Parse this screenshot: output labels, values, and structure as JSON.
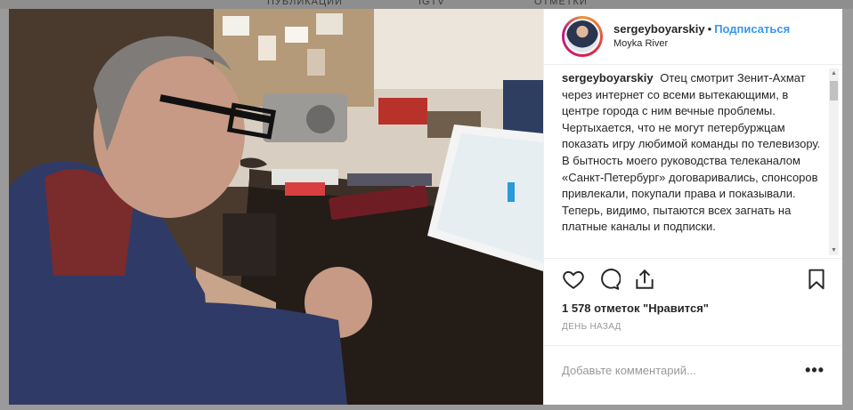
{
  "background_tabs": [
    "Публикации",
    "IGTV",
    "Отметки"
  ],
  "post": {
    "username": "sergeyboyarskiy",
    "separator": "•",
    "follow_label": "Подписаться",
    "location": "Moyka River",
    "caption_username": "sergeyboyarskiy",
    "caption_text": "Отец смотрит Зенит-Ахмат через интернет со всеми вытекающими, в центре города с ним вечные проблемы. Чертыхается, что не могут петербуржцам показать игру любимой команды по телевизору. В бытность моего руководства телеканалом «Санкт-Петербург» договаривались, спонсоров привлекали, покупали права и показывали. Теперь, видимо, пытаются всех загнать на платные каналы и подписки.",
    "likes": "1 578 отметок \"Нравится\"",
    "time": "ДЕНЬ НАЗАД",
    "comment_placeholder": "Добавьте комментарий...",
    "more_label": "•••"
  },
  "icons": {
    "like": "heart-icon",
    "comment": "comment-bubble-icon",
    "share": "share-icon",
    "save": "bookmark-icon"
  },
  "colors": {
    "accent": "#3897f0",
    "text": "#262626",
    "muted": "#999999"
  }
}
